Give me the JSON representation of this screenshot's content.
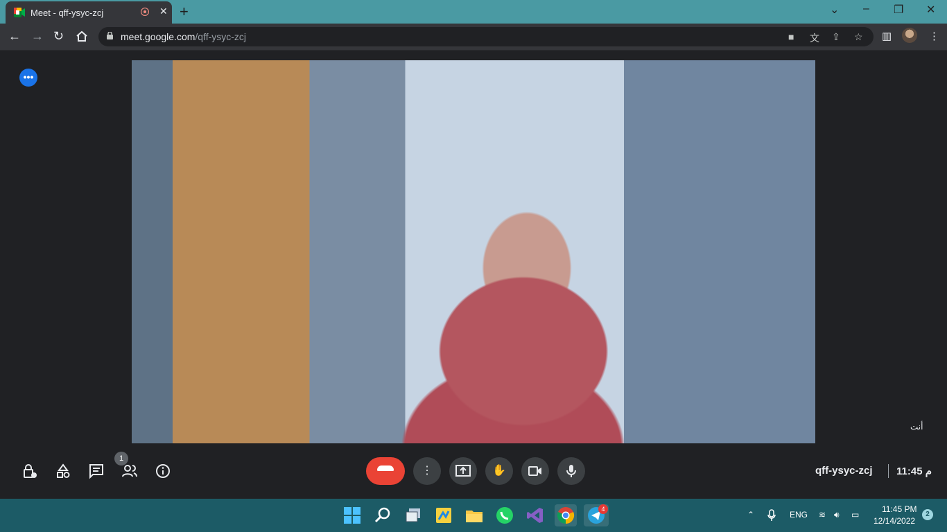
{
  "browser": {
    "tab_title": "Meet - qff-ysyc-zcj",
    "new_tab_symbol": "+",
    "url_host": "meet.google.com",
    "url_path": "/qff-ysyc-zcj"
  },
  "meet": {
    "self_label": "أنت",
    "participant_count": "1",
    "meeting_code": "qff-ysyc-zcj",
    "time": "11:45",
    "time_suffix": "م",
    "end_call_color": "#ea4335"
  },
  "taskbar": {
    "lang": "ENG",
    "clock_time": "11:45 PM",
    "clock_date": "12/14/2022",
    "notifications": "2",
    "telegram_badge": "4",
    "apps": [
      "windows-start-icon",
      "search-icon",
      "task-view-icon",
      "app-icon",
      "file-explorer-icon",
      "whatsapp-icon",
      "visual-studio-icon",
      "chrome-icon",
      "telegram-icon"
    ]
  },
  "colors": {
    "titlebar": "#4a9aa3",
    "taskbar": "#1c5b66",
    "meet_bg": "#202124",
    "accent": "#1a73e8"
  }
}
